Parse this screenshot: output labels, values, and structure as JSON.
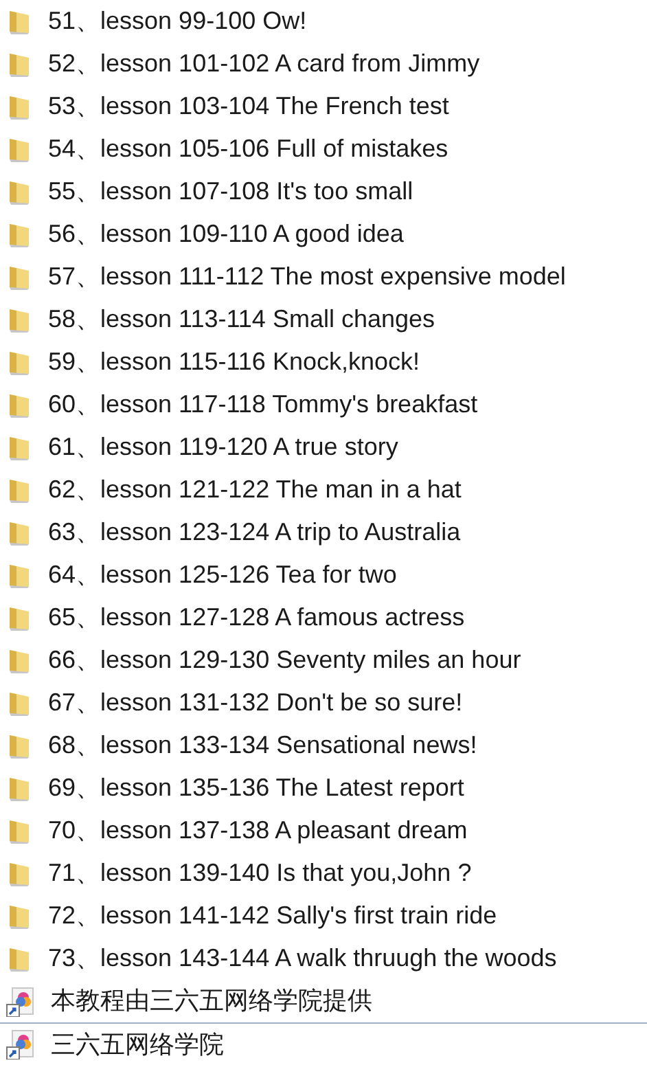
{
  "items": [
    {
      "kind": "folder",
      "name": "51、lesson 99-100 Ow!"
    },
    {
      "kind": "folder",
      "name": "52、lesson 101-102 A card from Jimmy"
    },
    {
      "kind": "folder",
      "name": "53、lesson 103-104 The French test"
    },
    {
      "kind": "folder",
      "name": "54、lesson 105-106 Full of mistakes"
    },
    {
      "kind": "folder",
      "name": "55、lesson 107-108 It's too small"
    },
    {
      "kind": "folder",
      "name": "56、lesson 109-110 A good idea"
    },
    {
      "kind": "folder",
      "name": "57、lesson 111-112 The most expensive model"
    },
    {
      "kind": "folder",
      "name": "58、lesson 113-114 Small changes"
    },
    {
      "kind": "folder",
      "name": "59、lesson 115-116 Knock,knock!"
    },
    {
      "kind": "folder",
      "name": "60、lesson 117-118 Tommy's breakfast"
    },
    {
      "kind": "folder",
      "name": "61、lesson 119-120 A true story"
    },
    {
      "kind": "folder",
      "name": "62、lesson 121-122 The man in a hat"
    },
    {
      "kind": "folder",
      "name": "63、lesson 123-124 A trip to Australia"
    },
    {
      "kind": "folder",
      "name": "64、lesson 125-126 Tea for two"
    },
    {
      "kind": "folder",
      "name": "65、lesson 127-128 A famous actress"
    },
    {
      "kind": "folder",
      "name": "66、lesson 129-130 Seventy miles an hour"
    },
    {
      "kind": "folder",
      "name": "67、lesson 131-132 Don't be so sure!"
    },
    {
      "kind": "folder",
      "name": "68、lesson 133-134 Sensational news!"
    },
    {
      "kind": "folder",
      "name": "69、lesson 135-136 The Latest report"
    },
    {
      "kind": "folder",
      "name": "70、lesson 137-138 A pleasant dream"
    },
    {
      "kind": "folder",
      "name": "71、lesson 139-140 Is that you,John ?"
    },
    {
      "kind": "folder",
      "name": "72、lesson 141-142 Sally's first train ride"
    },
    {
      "kind": "folder",
      "name": "73、lesson 143-144 A walk thruugh the woods"
    },
    {
      "kind": "shortcut",
      "name": "本教程由三六五网络学院提供"
    },
    {
      "kind": "shortcut",
      "name": "三六五网络学院"
    }
  ]
}
